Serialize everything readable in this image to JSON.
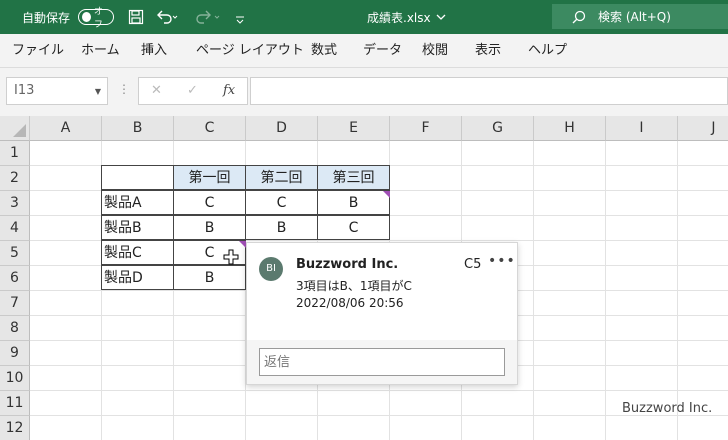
{
  "titlebar": {
    "autosave_label": "自動保存",
    "autosave_state": "オフ",
    "filename": "成績表.xlsx",
    "search_placeholder": "検索 (Alt+Q)"
  },
  "menu": [
    "ファイル",
    "ホーム",
    "挿入",
    "ページ レイアウト",
    "数式",
    "データ",
    "校閲",
    "表示",
    "ヘルプ"
  ],
  "formula": {
    "namebox": "I13",
    "fx": "fx",
    "value": ""
  },
  "columns": [
    "A",
    "B",
    "C",
    "D",
    "E",
    "F",
    "G",
    "H",
    "I",
    "J"
  ],
  "rows": [
    "1",
    "2",
    "3",
    "4",
    "5",
    "6",
    "7",
    "8",
    "9",
    "10",
    "11",
    "12"
  ],
  "table": {
    "headers": [
      "第一回",
      "第二回",
      "第三回"
    ],
    "rows": [
      {
        "label": "製品A",
        "values": [
          "C",
          "C",
          "B"
        ]
      },
      {
        "label": "製品B",
        "values": [
          "B",
          "B",
          "C"
        ]
      },
      {
        "label": "製品C",
        "values": [
          "C"
        ]
      },
      {
        "label": "製品D",
        "values": [
          "B"
        ]
      }
    ]
  },
  "comment": {
    "avatar": "BI",
    "author": "Buzzword Inc.",
    "cell": "C5",
    "more": "•••",
    "text": "3項目はB、1項目がC",
    "date": "2022/08/06 20:56",
    "reply_placeholder": "返信"
  },
  "watermark": "Buzzword Inc.",
  "colors": {
    "accent": "#217346",
    "header_fill": "#dce9f5",
    "comment_marker": "#a04fb5"
  }
}
